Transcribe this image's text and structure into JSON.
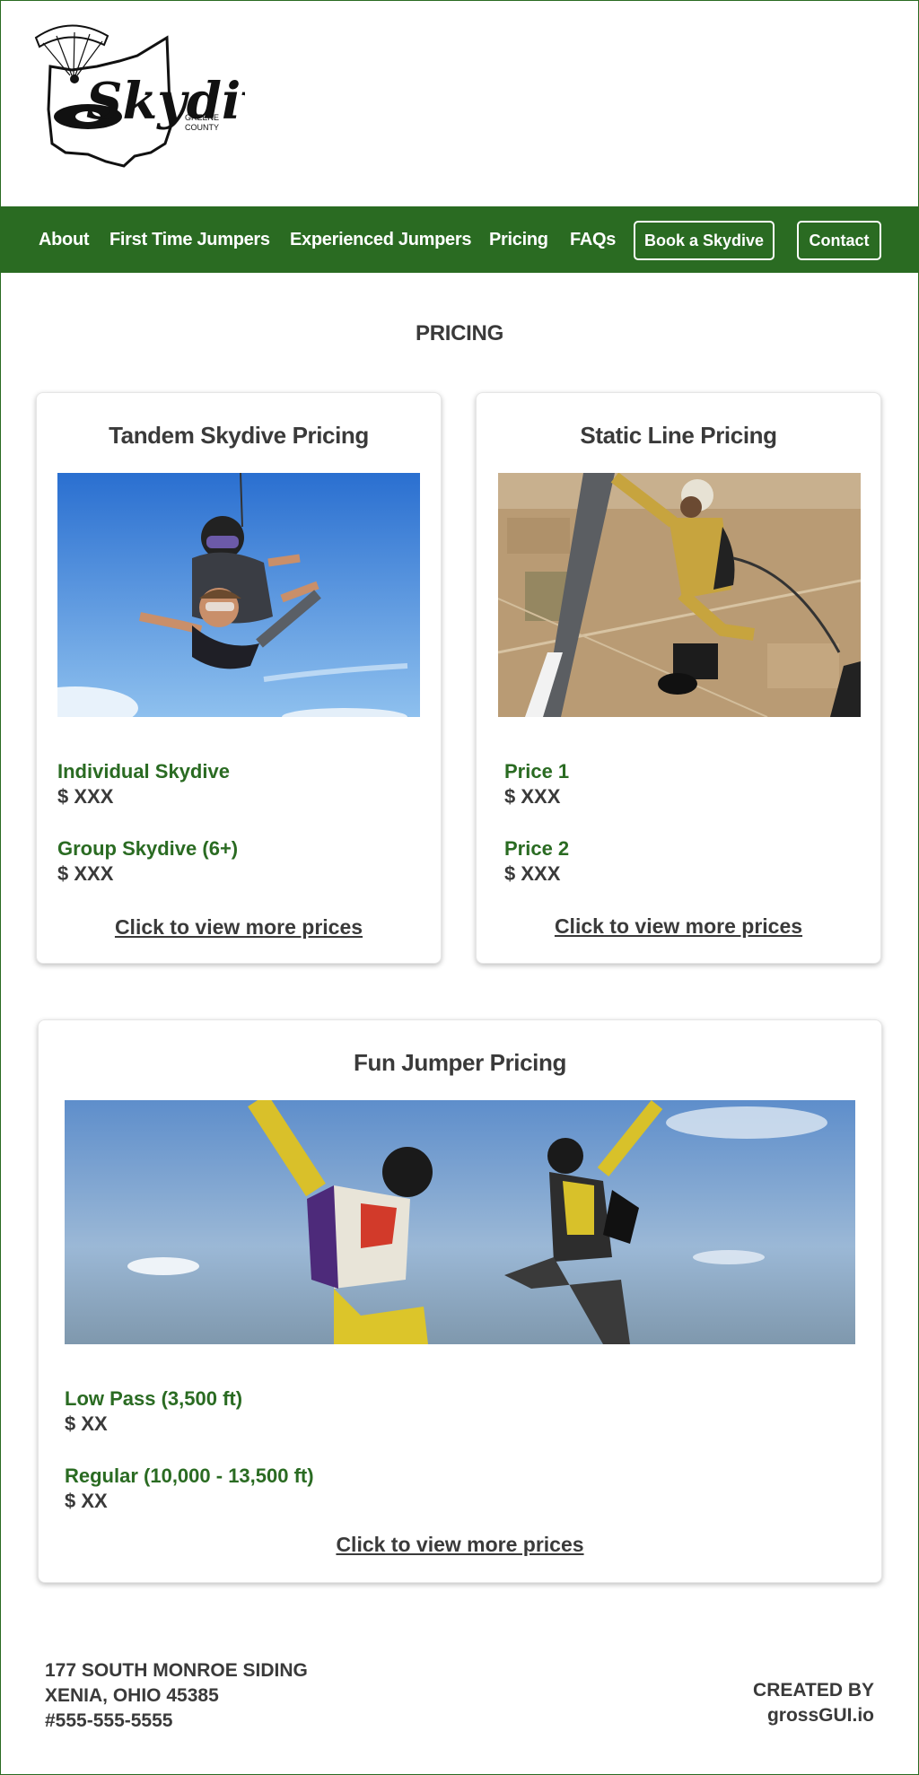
{
  "brand": {
    "logo_word": "Skydive",
    "logo_sub": "GREENE COUNTY",
    "color_green": "#2a6b22"
  },
  "nav": {
    "links": [
      "About",
      "First Time Jumpers",
      "Experienced Jumpers",
      "Pricing",
      "FAQs"
    ],
    "book_button": "Book a Skydive",
    "contact_button": "Contact"
  },
  "page": {
    "title": "PRICING"
  },
  "cards": {
    "tandem": {
      "title": "Tandem Skydive Pricing",
      "photo_icon": "tandem-skydivers-photo",
      "items": [
        {
          "label": "Individual Skydive",
          "price": "$ XXX"
        },
        {
          "label": "Group Skydive (6+)",
          "price": "$ XXX"
        }
      ],
      "more": "Click to view more prices"
    },
    "static": {
      "title": "Static Line Pricing",
      "photo_icon": "static-line-jumper-photo",
      "items": [
        {
          "label": "Price 1",
          "price": "$ XXX"
        },
        {
          "label": "Price 2",
          "price": "$ XXX"
        }
      ],
      "more": "Click to view more prices"
    },
    "fun": {
      "title": "Fun Jumper Pricing",
      "photo_icon": "freefall-jumpers-photo",
      "items": [
        {
          "label": "Low Pass (3,500 ft)",
          "price": "$ XX"
        },
        {
          "label": "Regular (10,000 - 13,500 ft)",
          "price": "$ XX"
        }
      ],
      "more": "Click to view more prices"
    }
  },
  "footer": {
    "address_line1": "177 SOUTH MONROE SIDING",
    "address_line2": "XENIA, OHIO 45385",
    "phone": "#555-555-5555",
    "credit_line1": "CREATED BY",
    "credit_line2": "grossGUI.io"
  }
}
